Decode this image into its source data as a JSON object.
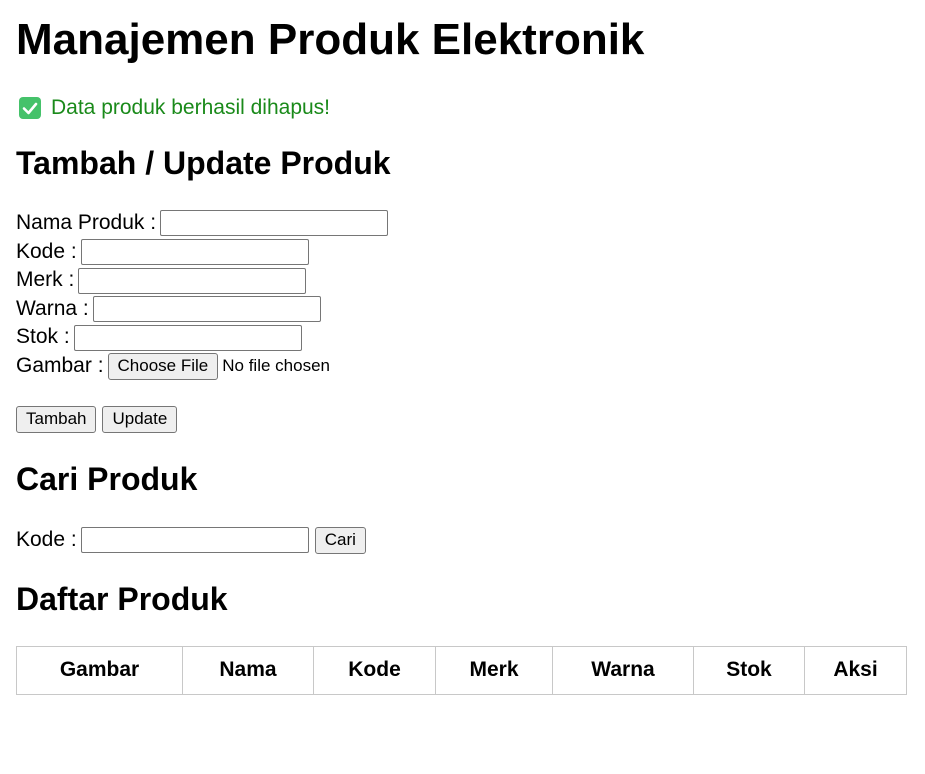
{
  "page": {
    "title": "Manajemen Produk Elektronik"
  },
  "alert": {
    "icon": "check-icon",
    "color": "#1a8a1a",
    "message": "Data produk berhasil dihapus!"
  },
  "form": {
    "heading": "Tambah / Update Produk",
    "fields": {
      "nama": {
        "label": "Nama Produk :",
        "value": ""
      },
      "kode": {
        "label": "Kode :",
        "value": ""
      },
      "merk": {
        "label": "Merk :",
        "value": ""
      },
      "warna": {
        "label": "Warna :",
        "value": ""
      },
      "stok": {
        "label": "Stok :",
        "value": ""
      },
      "gambar": {
        "label": "Gambar :",
        "button": "Choose File",
        "status": "No file chosen"
      }
    },
    "buttons": {
      "add": "Tambah",
      "update": "Update"
    }
  },
  "search": {
    "heading": "Cari Produk",
    "label": "Kode :",
    "value": "",
    "button": "Cari"
  },
  "list": {
    "heading": "Daftar Produk",
    "columns": [
      "Gambar",
      "Nama",
      "Kode",
      "Merk",
      "Warna",
      "Stok",
      "Aksi"
    ]
  }
}
